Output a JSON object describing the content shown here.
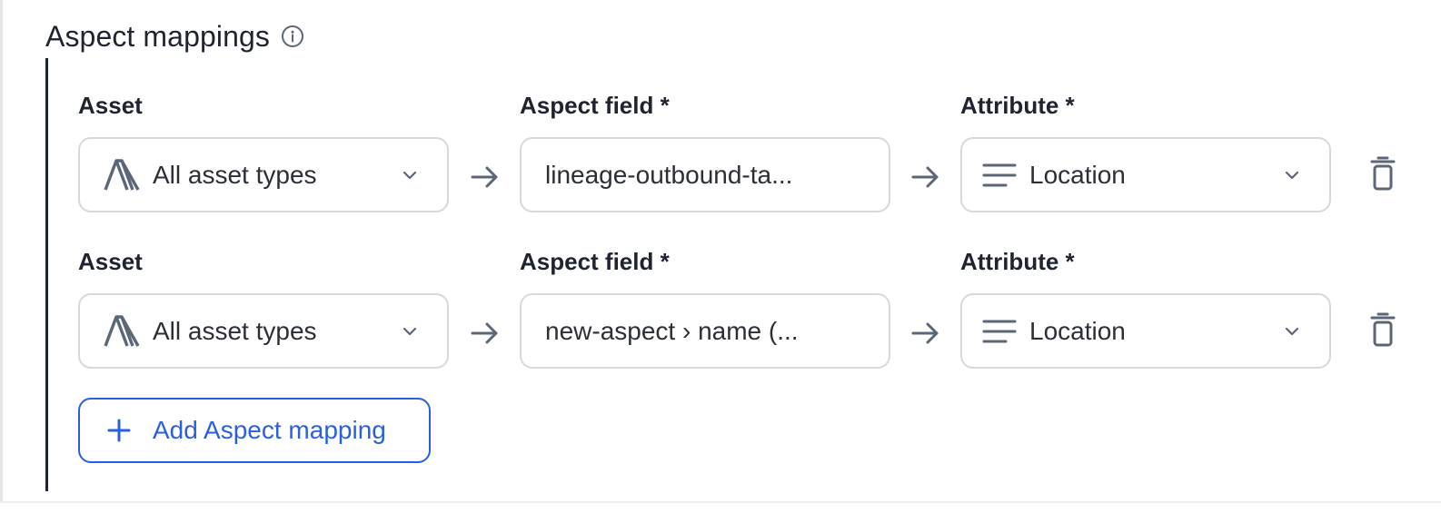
{
  "section": {
    "title": "Aspect mappings",
    "info_icon": "info-circle-icon"
  },
  "mappings": [
    {
      "asset_label": "Asset",
      "asset_value": "All asset types",
      "asset_icon": "atlan-logo-icon",
      "aspect_field_label": "Aspect field *",
      "aspect_field_value": "lineage-outbound-ta...",
      "attribute_label": "Attribute *",
      "attribute_value": "Location",
      "attribute_icon": "text-lines-icon"
    },
    {
      "asset_label": "Asset",
      "asset_value": "All asset types",
      "asset_icon": "atlan-logo-icon",
      "aspect_field_label": "Aspect field *",
      "aspect_field_value": "new-aspect › name (...",
      "attribute_label": "Attribute *",
      "attribute_value": "Location",
      "attribute_icon": "text-lines-icon"
    }
  ],
  "add_button": {
    "label": "Add Aspect mapping"
  },
  "colors": {
    "accent": "#2b5fe0",
    "text": "#1f2430",
    "icon": "#5b6677",
    "border": "#d5d8dd"
  }
}
